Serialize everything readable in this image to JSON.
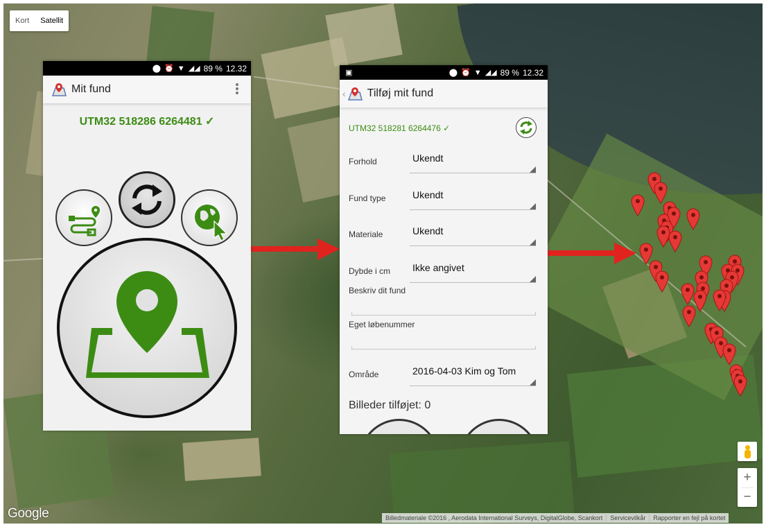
{
  "map": {
    "type_control": {
      "map_label": "Kort",
      "satellite_label": "Satellit",
      "selected": "Satellit"
    },
    "logo_text": "Google",
    "attribution": {
      "imagery": "Billedmateriale ©2016 , Aerodata International Surveys, DigitalGlobe, Scankort",
      "terms": "Servicevilkår",
      "report": "Rapporter en fejl på kortet"
    },
    "zoom": {
      "in_label": "+",
      "out_label": "−"
    },
    "colors": {
      "marker": "#e53935",
      "arrow": "#e0231e"
    }
  },
  "phone1": {
    "status": {
      "battery": "89 %",
      "time": "12.32"
    },
    "title": "Mit fund",
    "utm": "UTM32 518286 6264481 ✓",
    "colors": {
      "accent": "#3c8c14"
    }
  },
  "phone2": {
    "status": {
      "battery": "89 %",
      "time": "12.32"
    },
    "title": "Tilføj mit fund",
    "utm": "UTM32 518281 6264476 ✓",
    "fields": [
      {
        "label": "Forhold",
        "value": "Ukendt"
      },
      {
        "label": "Fund type",
        "value": "Ukendt"
      },
      {
        "label": "Materiale",
        "value": "Ukendt"
      },
      {
        "label": "Dybde i cm",
        "value": "Ikke angivet"
      }
    ],
    "text_fields": [
      {
        "label": "Beskriv dit fund",
        "value": ""
      },
      {
        "label": "Eget løbenummer",
        "value": ""
      }
    ],
    "area": {
      "label": "Område",
      "value": "2016-04-03 Kim og Tom"
    },
    "images_added": "Billeder tilføjet: 0"
  }
}
